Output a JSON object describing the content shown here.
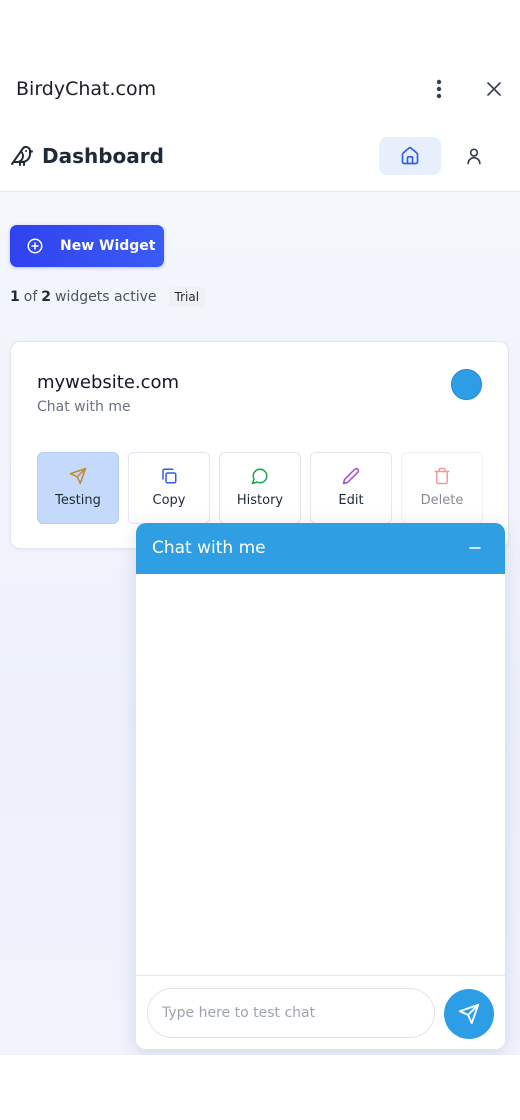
{
  "window": {
    "title": "BirdyChat.com",
    "menu_icon": "kebab-vertical-icon",
    "close_icon": "close-icon"
  },
  "header": {
    "title": "Dashboard",
    "logo_icon": "bird-icon",
    "home_icon": "home-icon",
    "profile_icon": "user-icon"
  },
  "toolbar": {
    "new_widget_label": "New Widget",
    "active_count": "1",
    "of_text": "of",
    "total_count": "2",
    "suffix_text": "widgets active",
    "plan_badge": "Trial"
  },
  "widget": {
    "domain": "mywebsite.com",
    "subtitle": "Chat with me",
    "color": "#2d9ee6",
    "actions": [
      {
        "label": "Testing",
        "icon": "send-icon",
        "color": "#c08a2b",
        "state": "active"
      },
      {
        "label": "Copy",
        "icon": "copy-icon",
        "color": "#2f5fe8",
        "state": "normal"
      },
      {
        "label": "History",
        "icon": "chat-bubble-icon",
        "color": "#16a34a",
        "state": "normal"
      },
      {
        "label": "Edit",
        "icon": "pencil-icon",
        "color": "#a344e0",
        "state": "normal"
      },
      {
        "label": "Delete",
        "icon": "trash-icon",
        "color": "#ef4444",
        "state": "disabled"
      }
    ]
  },
  "chat": {
    "title": "Chat with me",
    "minimize_icon": "minus-icon",
    "input_placeholder": "Type here to test chat",
    "input_value": "",
    "send_icon": "send-icon",
    "accent": "#2f9ee3"
  },
  "colors": {
    "primary": "#2f42ee",
    "accent_blue": "#2d9ee6",
    "active_tab_bg": "#e7effd"
  }
}
